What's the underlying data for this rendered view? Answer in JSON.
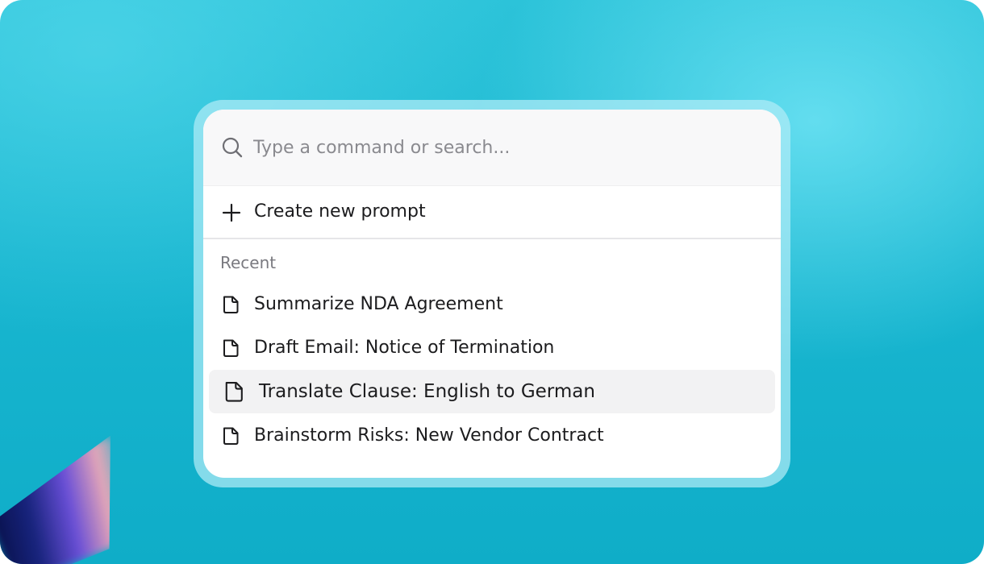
{
  "search": {
    "placeholder": "Type a command or search...",
    "icon": "search-icon"
  },
  "create": {
    "label": "Create new prompt",
    "icon": "plus-icon"
  },
  "recent": {
    "heading": "Recent",
    "items": [
      {
        "label": "Summarize NDA Agreement",
        "icon": "document-icon",
        "highlighted": false
      },
      {
        "label": "Draft Email: Notice of Termination",
        "icon": "document-icon",
        "highlighted": false
      },
      {
        "label": "Translate Clause: English to German",
        "icon": "document-icon",
        "highlighted": true
      },
      {
        "label": "Brainstorm Risks: New Vendor Contract",
        "icon": "document-icon",
        "highlighted": false
      }
    ]
  },
  "colors": {
    "background_accent": "#19b6d0",
    "highlight_row": "#f2f2f3",
    "text_primary": "#1c1c1e",
    "text_muted": "#7a7a80"
  }
}
